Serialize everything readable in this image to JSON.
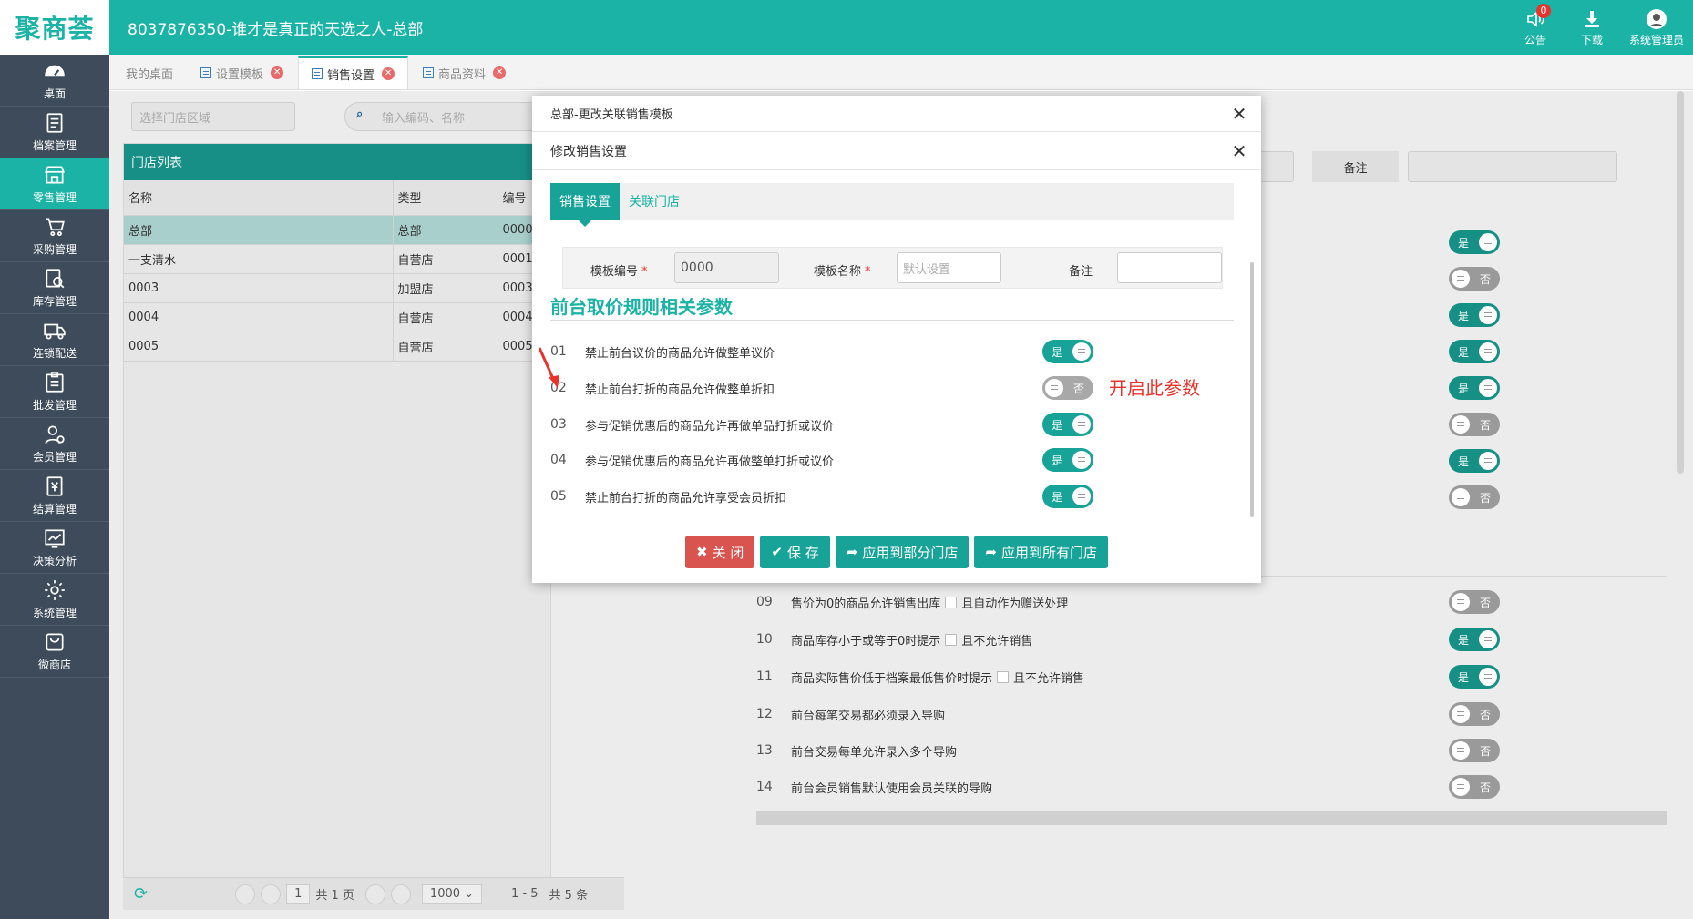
{
  "header": {
    "logo": "聚商荟",
    "title": "8037876350-谁才是真正的天选之人-总部",
    "actions": [
      {
        "label": "公告",
        "icon": "speaker-icon",
        "badge": "0"
      },
      {
        "label": "下载",
        "icon": "download-icon"
      },
      {
        "label": "系统管理员",
        "icon": "user-avatar-icon"
      }
    ]
  },
  "sidebar": {
    "items": [
      {
        "label": "桌面",
        "icon": "dashboard-icon"
      },
      {
        "label": "档案管理",
        "icon": "archive-icon"
      },
      {
        "label": "零售管理",
        "icon": "store-icon",
        "active": true
      },
      {
        "label": "采购管理",
        "icon": "cart-icon"
      },
      {
        "label": "库存管理",
        "icon": "inventory-icon"
      },
      {
        "label": "连锁配送",
        "icon": "truck-icon"
      },
      {
        "label": "批发管理",
        "icon": "wholesale-icon"
      },
      {
        "label": "会员管理",
        "icon": "member-icon"
      },
      {
        "label": "结算管理",
        "icon": "settlement-icon"
      },
      {
        "label": "决策分析",
        "icon": "chart-icon"
      },
      {
        "label": "系统管理",
        "icon": "gear-icon"
      },
      {
        "label": "微商店",
        "icon": "shop-bag-icon"
      }
    ]
  },
  "tabs": [
    {
      "label": "我的桌面",
      "closable": false
    },
    {
      "label": "设置模板",
      "closable": true
    },
    {
      "label": "销售设置",
      "closable": true,
      "active": true
    },
    {
      "label": "商品资料",
      "closable": true
    }
  ],
  "background": {
    "store_area_placeholder": "选择门店区域",
    "search_placeholder": "输入编码、名称",
    "remark_label": "备注",
    "store_panel_title": "门店列表",
    "columns": [
      "名称",
      "类型",
      "编号"
    ],
    "rows": [
      [
        "总部",
        "总部",
        "0000"
      ],
      [
        "一支清水",
        "自营店",
        "0001"
      ],
      [
        "0003",
        "加盟店",
        "0003"
      ],
      [
        "0004",
        "自营店",
        "0004"
      ],
      [
        "0005",
        "自营店",
        "0005"
      ]
    ],
    "pager": {
      "page": "1",
      "total_pages": "共 1 页",
      "page_size": "1000",
      "range": "1 - 5",
      "total": "共 5 条"
    },
    "params": [
      {
        "num": "09",
        "text": "售价为0的商品允许销售出库",
        "extra": "且自动作为赠送处理",
        "state": "否"
      },
      {
        "num": "10",
        "text": "商品库存小于或等于0时提示",
        "extra": "且不允许销售",
        "state": "是"
      },
      {
        "num": "11",
        "text": "商品实际售价低于档案最低售价时提示",
        "extra": "且不允许销售",
        "state": "是"
      },
      {
        "num": "12",
        "text": "前台每笔交易都必须录入导购",
        "state": "否"
      },
      {
        "num": "13",
        "text": "前台交易每单允许录入多个导购",
        "state": "否"
      },
      {
        "num": "14",
        "text": "前台会员销售默认使用会员关联的导购",
        "state": "否"
      }
    ],
    "upper_toggles": [
      "是",
      "否",
      "是",
      "是",
      "是",
      "否",
      "是",
      "否"
    ]
  },
  "modal": {
    "outer_title": "总部-更改关联销售模板",
    "inner_title": "修改销售设置",
    "tabs": [
      "销售设置",
      "关联门店"
    ],
    "form": {
      "code_label": "模板编号",
      "code_value": "0000",
      "name_label": "模板名称",
      "name_placeholder": "默认设置",
      "remark_label": "备注",
      "remark_value": ""
    },
    "section_title": "前台取价规则相关参数",
    "rows": [
      {
        "num": "01",
        "text": "禁止前台议价的商品允许做整单议价",
        "state": "是"
      },
      {
        "num": "02",
        "text": "禁止前台打折的商品允许做整单折扣",
        "state": "否"
      },
      {
        "num": "03",
        "text": "参与促销优惠后的商品允许再做单品打折或议价",
        "state": "是"
      },
      {
        "num": "04",
        "text": "参与促销优惠后的商品允许再做整单打折或议价",
        "state": "是"
      },
      {
        "num": "05",
        "text": "禁止前台打折的商品允许享受会员折扣",
        "state": "是"
      }
    ],
    "annotation": "开启此参数",
    "buttons": {
      "close": "关 闭",
      "save": "保 存",
      "apply_some": "应用到部分门店",
      "apply_all": "应用到所有门店"
    }
  },
  "colors": {
    "brand": "#1bb3a6",
    "sidebar": "#3d4b5a",
    "danger": "#d9534f",
    "annotation": "#e8332c"
  }
}
